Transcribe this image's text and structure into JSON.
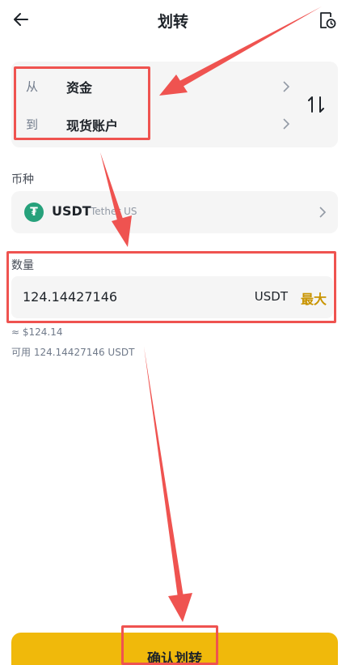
{
  "header": {
    "title": "划转",
    "back_icon": "arrow-left-icon",
    "history_icon": "record-history-icon"
  },
  "transfer": {
    "from_label": "从",
    "from_value": "资金",
    "to_label": "到",
    "to_value": "现货账户",
    "swap_icon": "swap-icon"
  },
  "coin": {
    "section_label": "币种",
    "code": "USDT",
    "name": "Tether US",
    "logo_glyph": "₮",
    "logo_color": "#26a17b"
  },
  "amount": {
    "section_label": "数量",
    "value": "124.14427146",
    "unit": "USDT",
    "max_label": "最大",
    "fiat_estimate": "≈ $124.14",
    "available": "可用 124.14427146 USDT"
  },
  "confirm": {
    "label": "确认划转"
  },
  "colors": {
    "accent": "#f0b90b",
    "max_text": "#c99400",
    "highlight": "#ef5350"
  }
}
